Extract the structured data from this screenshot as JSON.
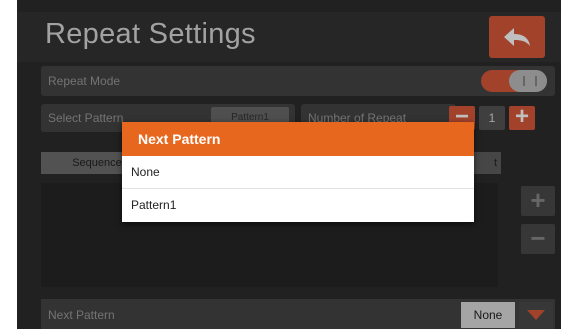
{
  "header": {
    "title": "Repeat Settings",
    "back_icon": "back-arrow-icon"
  },
  "rows": {
    "repeat_mode": {
      "label": "Repeat Mode",
      "toggle_on": true
    },
    "select_pattern": {
      "label": "Select Pattern",
      "button_label": "Pattern1"
    },
    "number_of_repeat": {
      "label": "Number of Repeat",
      "value": "1",
      "minus": "−",
      "plus": "+"
    }
  },
  "table": {
    "col1": "Sequence",
    "col2": "t"
  },
  "side_buttons": {
    "plus": "+",
    "minus": "−"
  },
  "next_pattern_row": {
    "label": "Next Pattern",
    "value": "None"
  },
  "dialog": {
    "title": "Next Pattern",
    "options": [
      "None",
      "Pattern1"
    ]
  },
  "colors": {
    "accent": "#d9583a",
    "dialog_header": "#e8671e",
    "background": "#2c2c2c"
  }
}
